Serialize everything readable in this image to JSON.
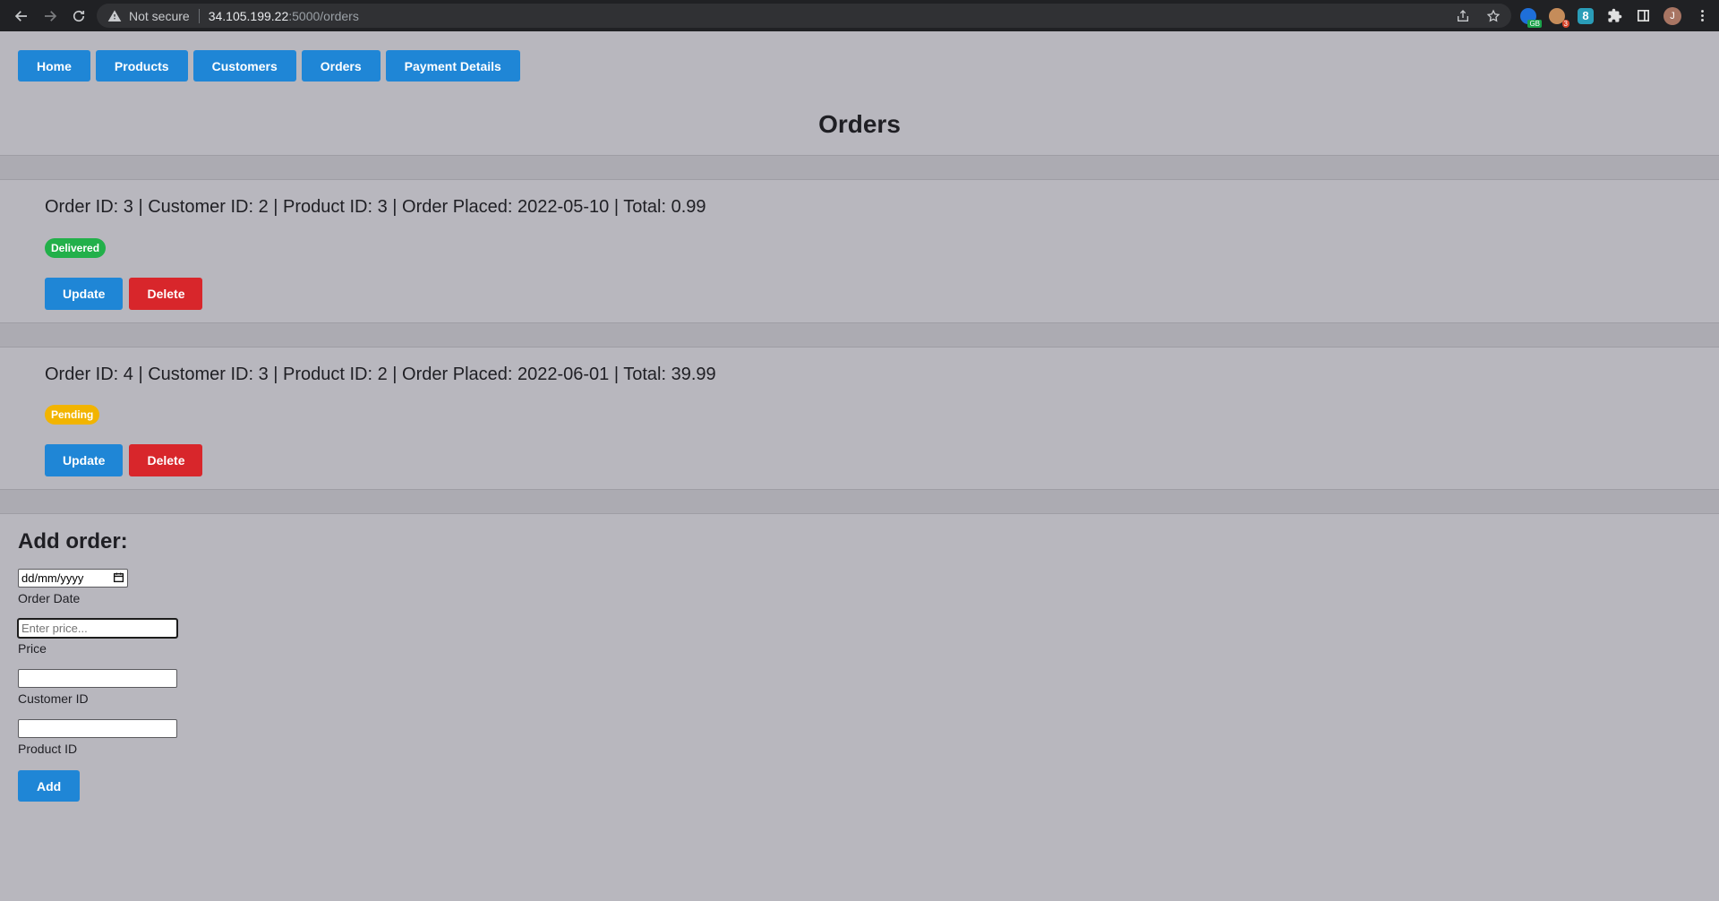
{
  "browser": {
    "security_label": "Not secure",
    "url_host": "34.105.199.22",
    "url_path": ":5000/orders",
    "ext_badge_1": "GB",
    "ext_badge_2": "3",
    "ext_3_label": "8",
    "avatar_initial": "J"
  },
  "nav": {
    "home": "Home",
    "products": "Products",
    "customers": "Customers",
    "orders": "Orders",
    "payment_details": "Payment Details"
  },
  "page_title": "Orders",
  "orders": [
    {
      "summary": "Order ID: 3 | Customer ID: 2 | Product ID: 3 | Order Placed: 2022-05-10 | Total: 0.99",
      "status": "Delivered",
      "status_color": "#22b04a",
      "update_label": "Update",
      "delete_label": "Delete"
    },
    {
      "summary": "Order ID: 4 | Customer ID: 3 | Product ID: 2 | Order Placed: 2022-06-01 | Total: 39.99",
      "status": "Pending",
      "status_color": "#f2b400",
      "update_label": "Update",
      "delete_label": "Delete"
    }
  ],
  "add_form": {
    "title": "Add order:",
    "order_date": {
      "value": "dd/mm/yyyy",
      "label": "Order Date"
    },
    "price": {
      "placeholder": "Enter price...",
      "label": "Price"
    },
    "customer_id": {
      "placeholder": "",
      "label": "Customer ID"
    },
    "product_id": {
      "placeholder": "",
      "label": "Product ID"
    },
    "submit_label": "Add"
  },
  "colors": {
    "primary": "#1f86d6",
    "danger": "#d8262b",
    "background": "#b8b7be"
  }
}
